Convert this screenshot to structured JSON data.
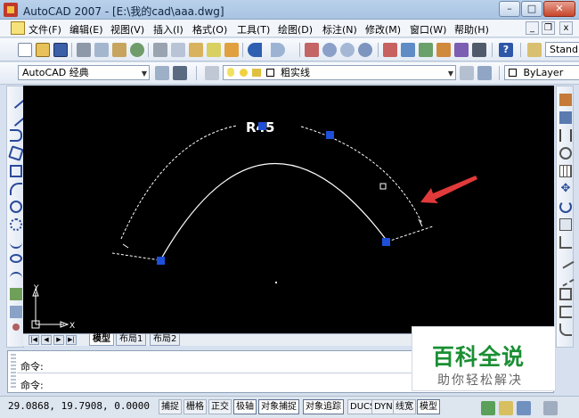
{
  "window": {
    "title": "AutoCAD 2007 - [E:\\我的cad\\aaa.dwg]",
    "minimize_label": "–",
    "maximize_label": "□",
    "close_label": "✕"
  },
  "menu": {
    "items": [
      "文件(F)",
      "编辑(E)",
      "视图(V)",
      "插入(I)",
      "格式(O)",
      "工具(T)",
      "绘图(D)",
      "标注(N)",
      "修改(M)",
      "窗口(W)",
      "帮助(H)"
    ],
    "mdi_min": "_",
    "mdi_restore": "❐",
    "mdi_close": "x"
  },
  "toolbar": {
    "text_style_value": "Stand"
  },
  "workspace": {
    "value": "AutoCAD 经典"
  },
  "layer": {
    "value": "粗实线"
  },
  "color_combo": {
    "value": "ByLayer"
  },
  "drawing": {
    "dimension_text": "R45",
    "axis_x": "X",
    "axis_y": "Y"
  },
  "layout_tabs": {
    "nav": [
      "|◀",
      "◀",
      "▶",
      "▶|"
    ],
    "tabs": [
      "模型",
      "布局1",
      "布局2"
    ]
  },
  "command": {
    "prompt1": "命令:",
    "prompt2": "命令:"
  },
  "status": {
    "coordinates": "29.0868, 19.7908, 0.0000",
    "toggles": [
      "捕捉",
      "栅格",
      "正交",
      "极轴",
      "对象捕捉",
      "对象追踪",
      "DUCS",
      "DYN",
      "线宽",
      "模型"
    ]
  },
  "watermark": {
    "brand": "百科全说",
    "slogan": "助你轻松解决"
  },
  "colors": {
    "canvas": "#000000",
    "grip": "#1d4fd8",
    "arrow": "#e23a3a",
    "watermark_green": "#1a8f33"
  }
}
